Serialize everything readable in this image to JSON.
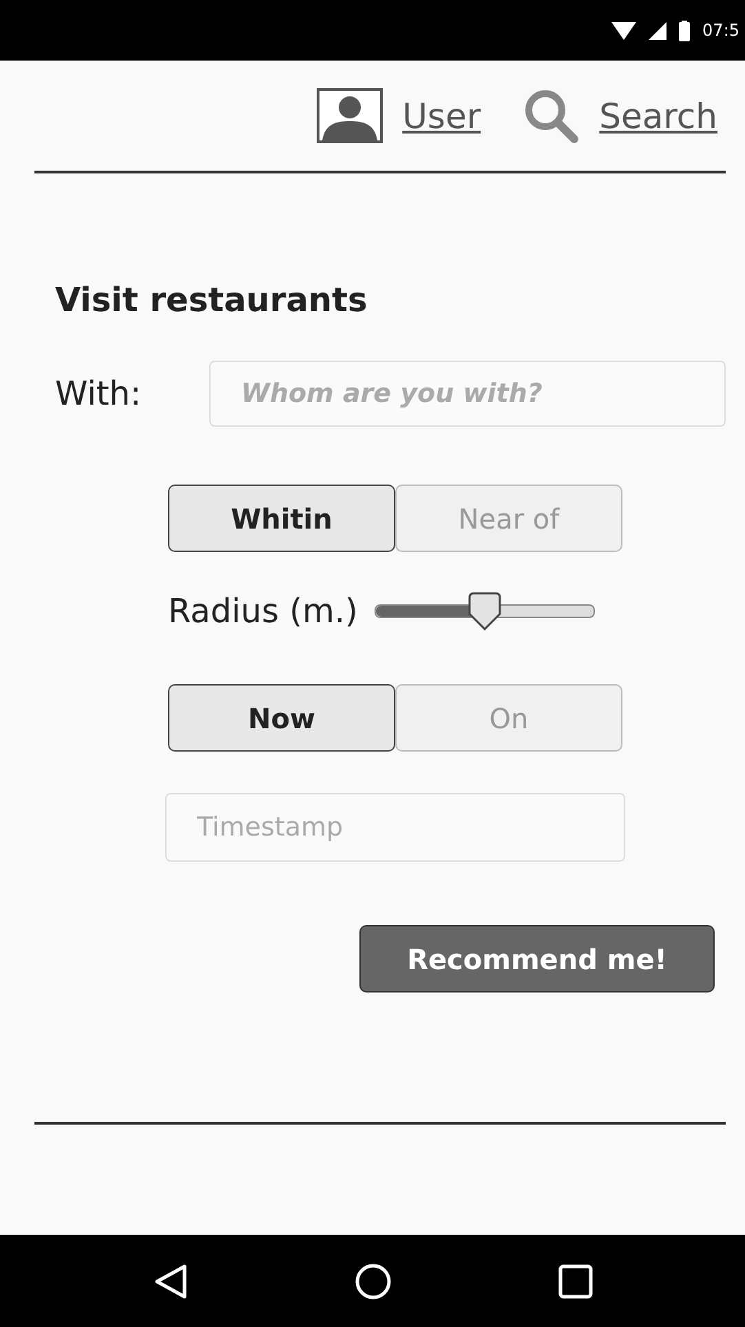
{
  "status_bar": {
    "time": "07:5"
  },
  "header": {
    "links": [
      {
        "kind": "user",
        "label": "User"
      },
      {
        "kind": "search",
        "label": "Search"
      }
    ]
  },
  "title": "Visit restaurants",
  "with": {
    "label": "With:",
    "placeholder": "Whom are you with?"
  },
  "place_toggle": [
    {
      "label": "Whitin",
      "selected": true
    },
    {
      "label": "Near of",
      "selected": false
    }
  ],
  "radius": {
    "label": "Radius (m.)",
    "level": 0.5
  },
  "time_toggle": [
    {
      "label": "Now",
      "selected": true
    },
    {
      "label": "On",
      "selected": false
    }
  ],
  "timestamp": {
    "placeholder": "Timestamp"
  },
  "action": "Recommend me!"
}
